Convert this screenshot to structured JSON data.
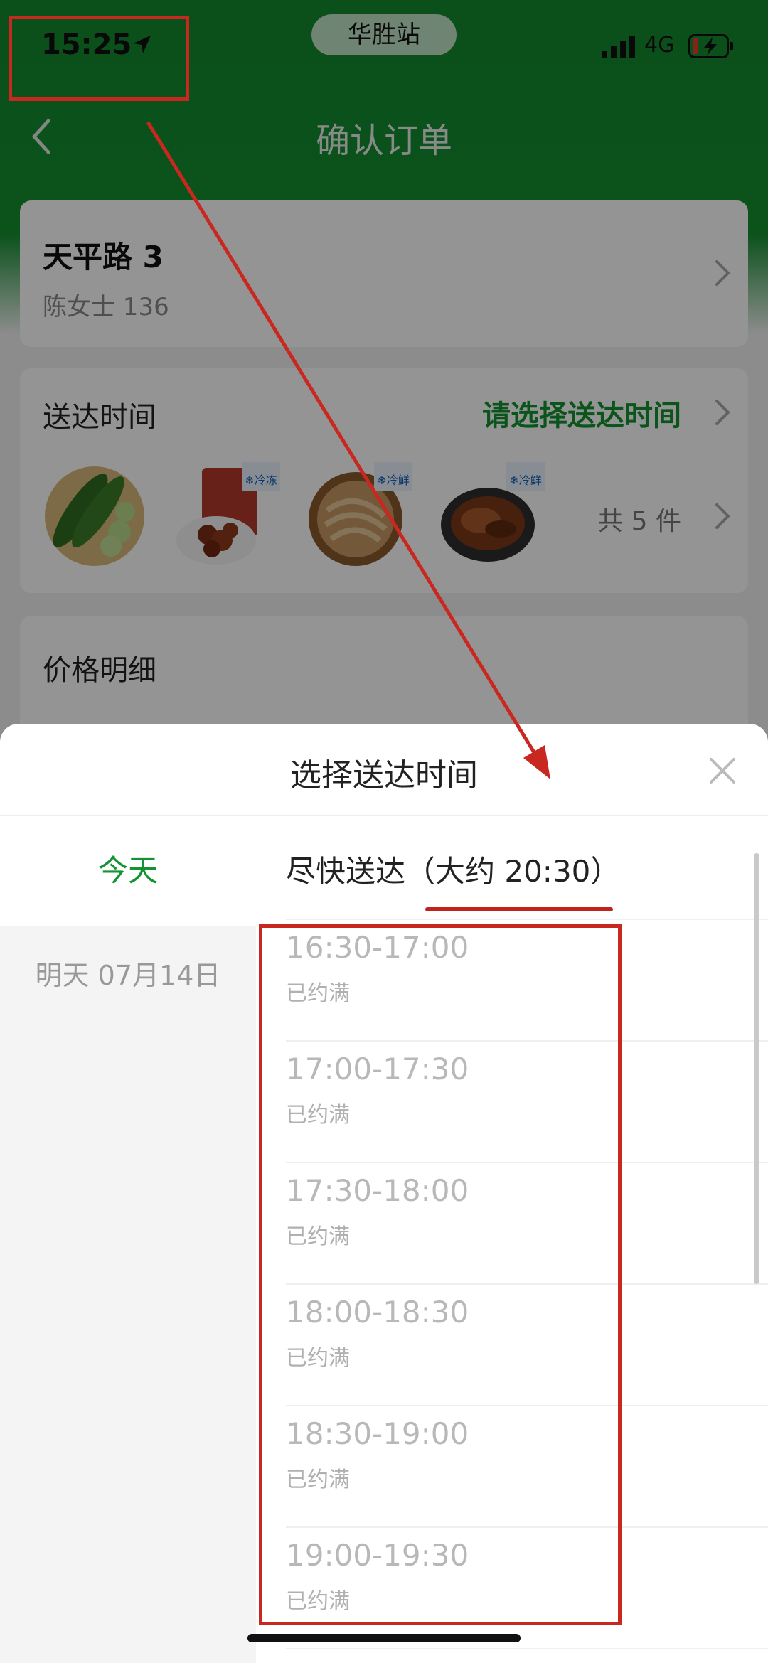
{
  "status_bar": {
    "time": "15:25",
    "station": "华胜站",
    "network": "4G",
    "icons": [
      "location-arrow-icon",
      "signal-icon",
      "battery-charging-icon"
    ]
  },
  "nav": {
    "title": "确认订单",
    "back_icon": "chevron-left-icon"
  },
  "address": {
    "title": "天平路 3",
    "subtitle": "陈女士 136"
  },
  "delivery": {
    "label": "送达时间",
    "hint": "请选择送达时间",
    "item_count": "共 5 件",
    "products": [
      {
        "name": "cucumber",
        "badge": ""
      },
      {
        "name": "braised-meat-pack",
        "badge": "❄冷冻"
      },
      {
        "name": "noodles",
        "badge": "❄冷鲜"
      },
      {
        "name": "braised-pork",
        "badge": "❄冷鲜"
      }
    ]
  },
  "price": {
    "label": "价格明细"
  },
  "sheet": {
    "title": "选择送达时间",
    "days": [
      {
        "label": "今天",
        "selected": true
      },
      {
        "label": "明天 07月14日",
        "selected": false
      }
    ],
    "asap": "尽快送达（大约 20:30）",
    "slots": [
      {
        "time": "16:30-17:00",
        "status": "已约满"
      },
      {
        "time": "17:00-17:30",
        "status": "已约满"
      },
      {
        "time": "17:30-18:00",
        "status": "已约满"
      },
      {
        "time": "18:00-18:30",
        "status": "已约满"
      },
      {
        "time": "18:30-19:00",
        "status": "已约满"
      },
      {
        "time": "19:00-19:30",
        "status": "已约满"
      }
    ]
  },
  "colors": {
    "brand_green": "#139331",
    "annotation_red": "#c8281f"
  }
}
